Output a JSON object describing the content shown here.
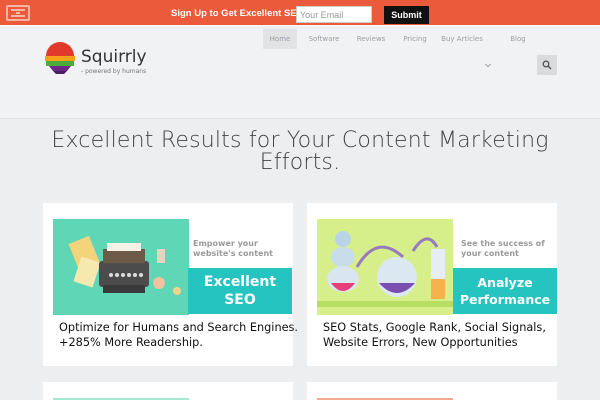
{
  "topbar": {
    "menu_icon": "menu-icon",
    "signup_text": "Sign Up to Get Excellent SEO",
    "email_placeholder": "Your Email",
    "submit_label": "Submit",
    "bg_color": "#ec5a3c"
  },
  "header": {
    "logo_name": "Squirrly",
    "logo_tagline": "- powered by humans",
    "nav": [
      {
        "label": "Home",
        "active": true
      },
      {
        "label": "Software"
      },
      {
        "label": "Reviews"
      },
      {
        "label": "Pricing"
      },
      {
        "label": "Buy Articles",
        "has_dropdown": true
      },
      {
        "label": "Blog"
      }
    ],
    "search_icon": "search-icon"
  },
  "hero": {
    "title_line1": "Excellent Results for Your Content Marketing",
    "title_line2": "Efforts."
  },
  "cards": [
    {
      "caption_line1": "Empower your",
      "caption_line2": "website's content",
      "label_line1": "Excellent",
      "label_line2": "SEO",
      "desc_line1": "Optimize for Humans and Search Engines.",
      "desc_line2": "+285% More Readership."
    },
    {
      "caption_line1": "See the success of",
      "caption_line2": "your content",
      "label_line1": "Analyze",
      "label_line2": "Performance",
      "desc_line1": "SEO Stats, Google Rank, Social Signals,",
      "desc_line2": "Website Errors, New Opportunities"
    }
  ],
  "colors": {
    "accent_teal": "#26c4c0",
    "promo_orange": "#ec5a3c"
  }
}
